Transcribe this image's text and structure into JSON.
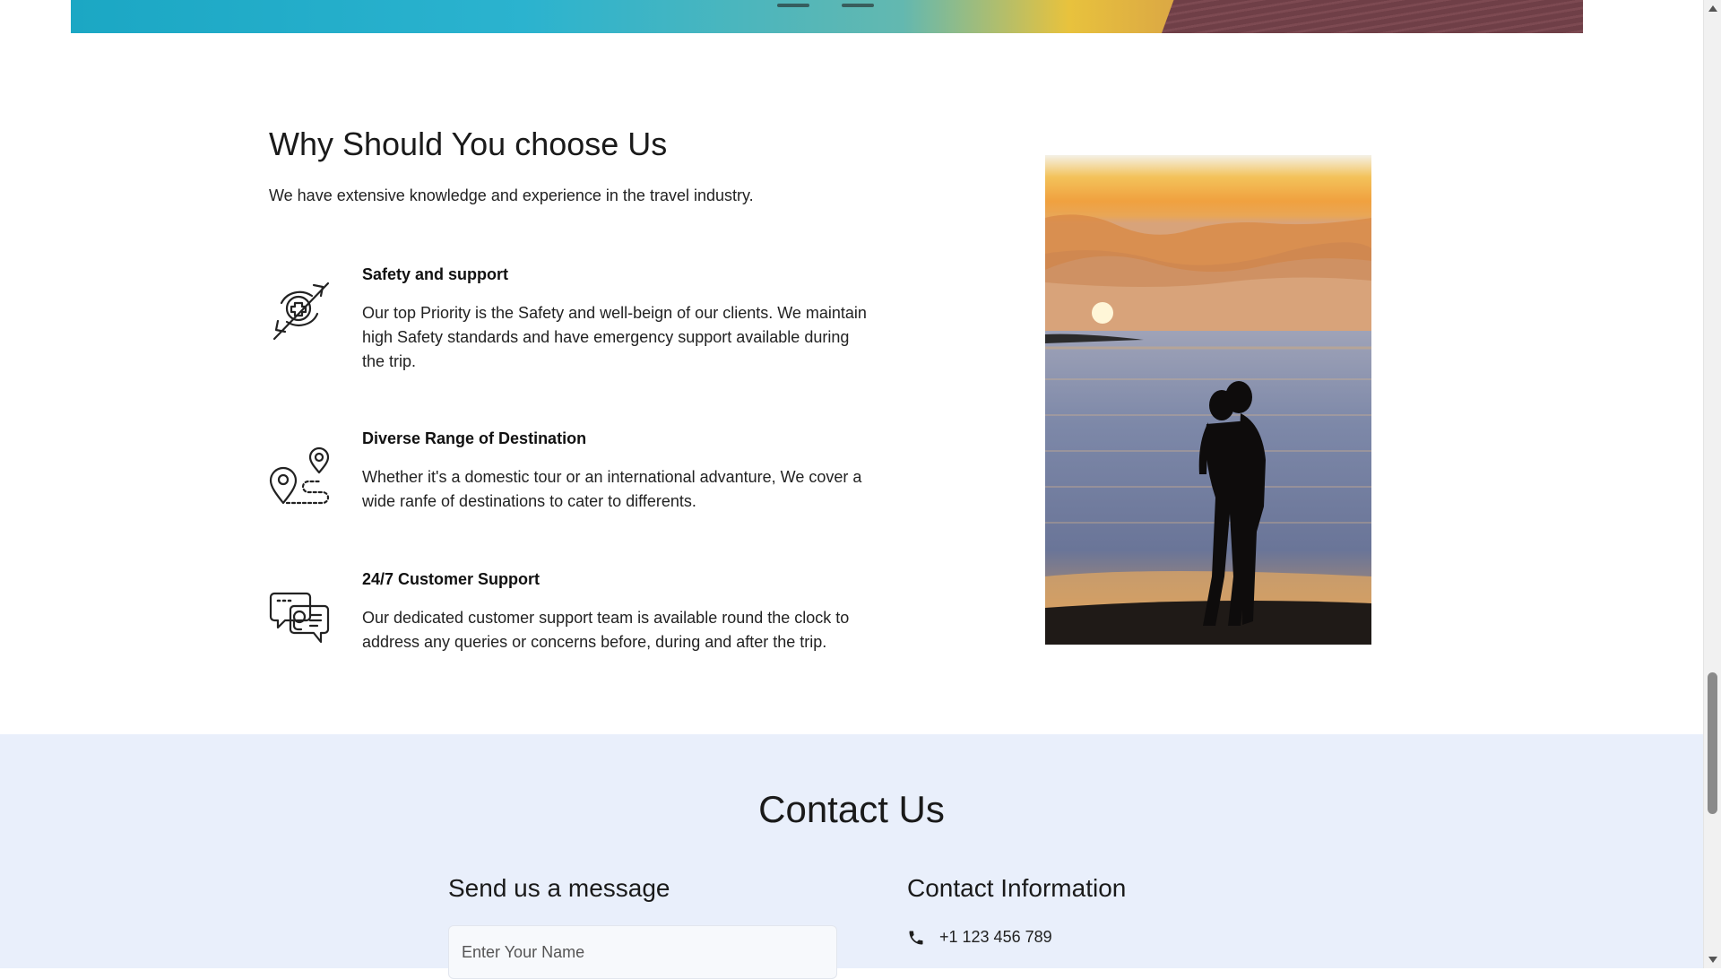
{
  "why": {
    "title": "Why Should You choose Us",
    "intro": "We have extensive knowledge and experience in the travel industry.",
    "features": [
      {
        "icon": "medical-safety-hands-icon",
        "title": "Safety and support",
        "description": "Our top Priority is the Safety and well-beign of our clients. We maintain high Safety standards and have emergency support available during the trip."
      },
      {
        "icon": "map-pins-route-icon",
        "title": "Diverse Range of Destination",
        "description": "Whether it's a domestic tour or an international advanture, We cover a wide ranfe of destinations to cater to differents."
      },
      {
        "icon": "customer-support-chat-icon",
        "title": "24/7 Customer Support",
        "description": "Our dedicated customer support team is available round the clock to address any queries or concerns before, during and after the trip."
      }
    ]
  },
  "contact": {
    "title": "Contact Us",
    "send_title": "Send us a message",
    "name_placeholder": "Enter Your Name",
    "info_title": "Contact Information",
    "phone": "+1 123 456 789"
  },
  "colors": {
    "contact_bg": "#e9effb",
    "text": "#1d1d1d"
  }
}
